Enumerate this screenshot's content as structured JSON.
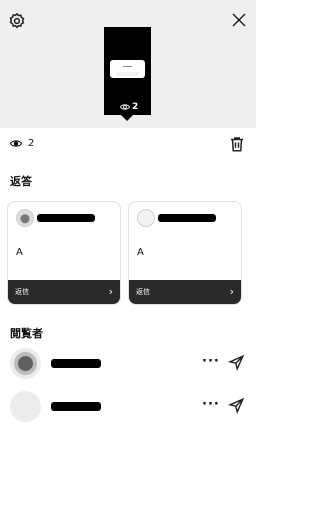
{
  "header": {
    "settings_icon": "gear-icon",
    "close_icon": "close-icon"
  },
  "story": {
    "view_count": "2",
    "eye_icon": "eye-icon"
  },
  "stats": {
    "view_count": "2",
    "delete_icon": "trash-icon"
  },
  "replies": {
    "title": "返答",
    "cards": [
      {
        "text": "A",
        "action_label": "返信",
        "chevron": "›"
      },
      {
        "text": "A",
        "action_label": "返信",
        "chevron": "›"
      }
    ]
  },
  "viewers": {
    "title": "閲覧者",
    "rows": [
      {
        "more_label": "···",
        "send_icon": "send-icon"
      },
      {
        "more_label": "···",
        "send_icon": "send-icon"
      }
    ]
  }
}
